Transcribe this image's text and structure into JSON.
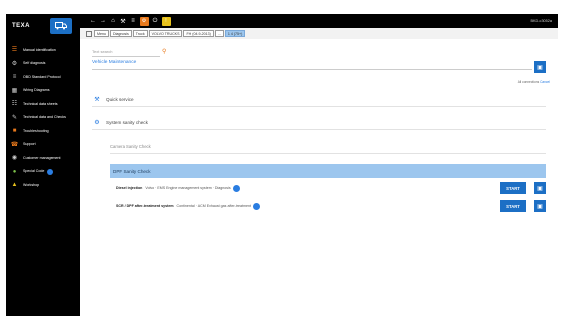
{
  "sidebar": {
    "logo": "TEXA",
    "items": [
      {
        "label": "Manual identification",
        "icon": "manual-id-icon",
        "color": "orange"
      },
      {
        "label": "Self diagnosis",
        "icon": "self-diagnosis-icon",
        "color": ""
      },
      {
        "label": "OBD Standard Protocol",
        "icon": "obd-icon",
        "color": ""
      },
      {
        "label": "Wiring Diagrams",
        "icon": "wiring-diagram-icon",
        "color": ""
      },
      {
        "label": "Technical data sheets",
        "icon": "data-sheets-icon",
        "color": ""
      },
      {
        "label": "Technical data and Checks",
        "icon": "tech-checks-icon",
        "color": ""
      },
      {
        "label": "Troubleshooting",
        "icon": "troubleshooting-icon",
        "color": "orange"
      },
      {
        "label": "Support",
        "icon": "support-icon",
        "color": "orange"
      },
      {
        "label": "Customer management",
        "icon": "customer-icon",
        "color": ""
      },
      {
        "label": "Special Code",
        "icon": "special-code-icon",
        "color": "green"
      },
      {
        "label": "Workshop",
        "icon": "workshop-icon",
        "color": "yellow"
      }
    ]
  },
  "topbar": {
    "right_text": "BKD-c3052a"
  },
  "breadcrumb": [
    "Menu",
    "Diagnosis",
    "Truck",
    "VOLVO TRUCKS",
    "FH (04.9-2013)",
    "...",
    "1 4 (75+)"
  ],
  "search": {
    "placeholder": "Text search"
  },
  "page_title": "Vehicle Maintenance",
  "top_right_note": "All connections",
  "top_right_link": "Cancel",
  "rows": [
    {
      "label": "Quick service",
      "icon": "wrench-icon"
    },
    {
      "label": "System sanity check",
      "icon": "gear-check-icon"
    }
  ],
  "subrow": "Camera Sanity Check",
  "section": "DPF Sanity Check",
  "items": [
    {
      "name": "Diesel injection",
      "detail": "Volvo · EMS Engine management system · Diagnosis",
      "action": "START"
    },
    {
      "name": "SCR / DPF after-treatment system",
      "detail": "Continental · ACM Exhaust gas after-treatment",
      "action": "START"
    }
  ],
  "colors": {
    "accent": "#1c6fc5",
    "highlight": "#9cc6ee",
    "orange": "#e8791c"
  }
}
